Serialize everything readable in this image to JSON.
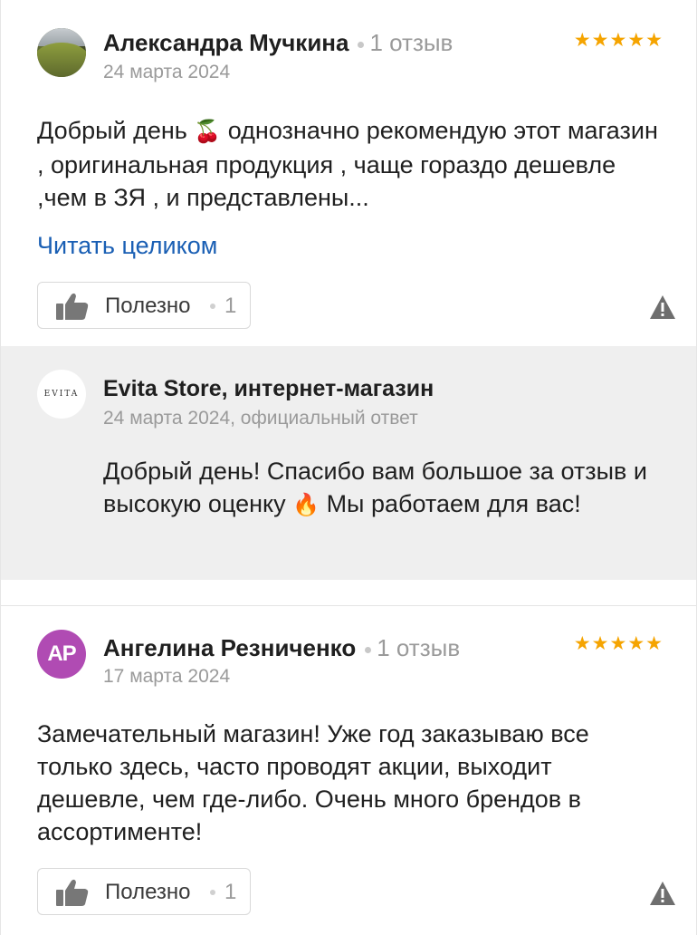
{
  "reviews": [
    {
      "author": "Александра Мучкина",
      "review_count": "1 отзыв",
      "date": "24 марта 2024",
      "stars": "★★★★★",
      "text_before_emoji": "Добрый день",
      "emoji": "🍒",
      "text_after_emoji": " однозначно рекомендую этот магазин , оригинальная продукция , чаще гораздо дешевле ,чем в ЗЯ , и представлены...",
      "read_more": "Читать целиком",
      "helpful_label": "Полезно",
      "helpful_count": "1",
      "reply": {
        "avatar_text": "EVITA",
        "name": "Evita Store, интернет-магазин",
        "date": "24 марта 2024, официальный ответ",
        "text_before_emoji": "Добрый день! Спасибо вам большое за отзыв и высокую оценку",
        "emoji": "🔥",
        "text_after_emoji": " Мы работаем для вас!"
      }
    },
    {
      "avatar_initials": "АР",
      "author": "Ангелина Резниченко",
      "review_count": "1 отзыв",
      "date": "17 марта 2024",
      "stars": "★★★★★",
      "text": "Замечательный магазин! Уже год заказываю все только здесь, часто проводят акции, выходит дешевле, чем где-либо. Очень много брендов в ассортименте!",
      "helpful_label": "Полезно",
      "helpful_count": "1"
    }
  ],
  "colors": {
    "star": "#f5a400",
    "link": "#1a5fb4",
    "reply_bg": "#efefef",
    "avatar_initials_bg": "#b04bb3"
  },
  "icons": [
    "thumb-up-icon",
    "warning-icon",
    "star-icon"
  ]
}
